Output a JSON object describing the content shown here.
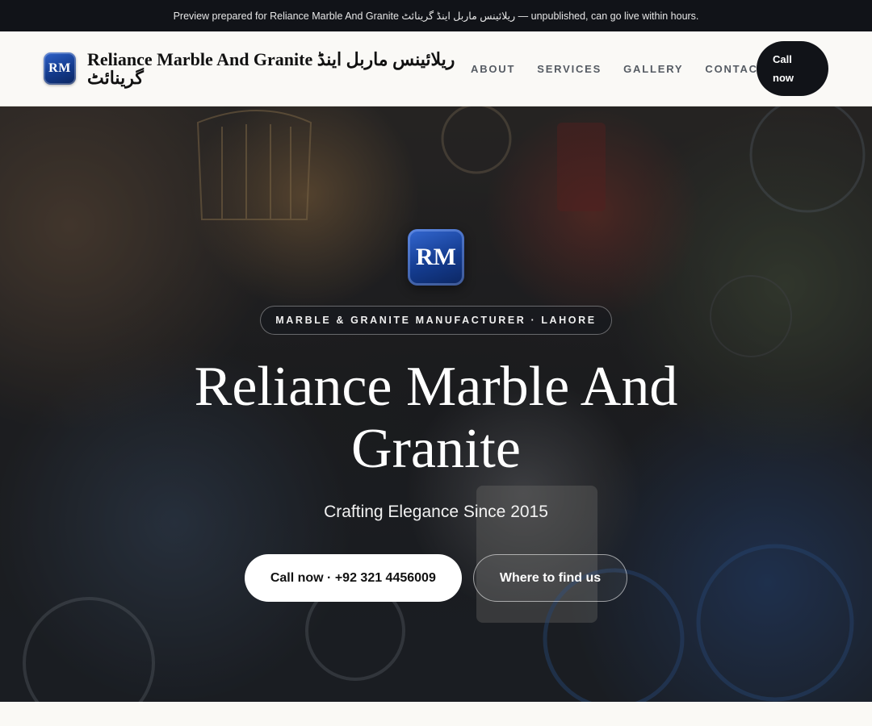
{
  "preview_banner": "Preview prepared for Reliance Marble And Granite ریلائینس ماربل اینڈ گرینائٹ — unpublished, can go live within hours.",
  "header": {
    "logo_initials": "RM",
    "brand_name": "Reliance Marble And Granite ریلائینس ماربل اینڈ گرینائٹ",
    "nav": [
      "ABOUT",
      "SERVICES",
      "GALLERY",
      "CONTACT"
    ],
    "call_button": "Call now"
  },
  "hero": {
    "logo_initials": "RM",
    "eyebrow": "MARBLE & GRANITE MANUFACTURER · LAHORE",
    "title": "Reliance Marble And Granite",
    "tagline": "Crafting Elegance Since 2015",
    "primary_cta": "Call now · +92 321 4456009",
    "secondary_cta": "Where to find us"
  },
  "colors": {
    "dark": "#111318",
    "brand_blue": "#1f4aa8",
    "page_bg": "#faf9f5"
  }
}
